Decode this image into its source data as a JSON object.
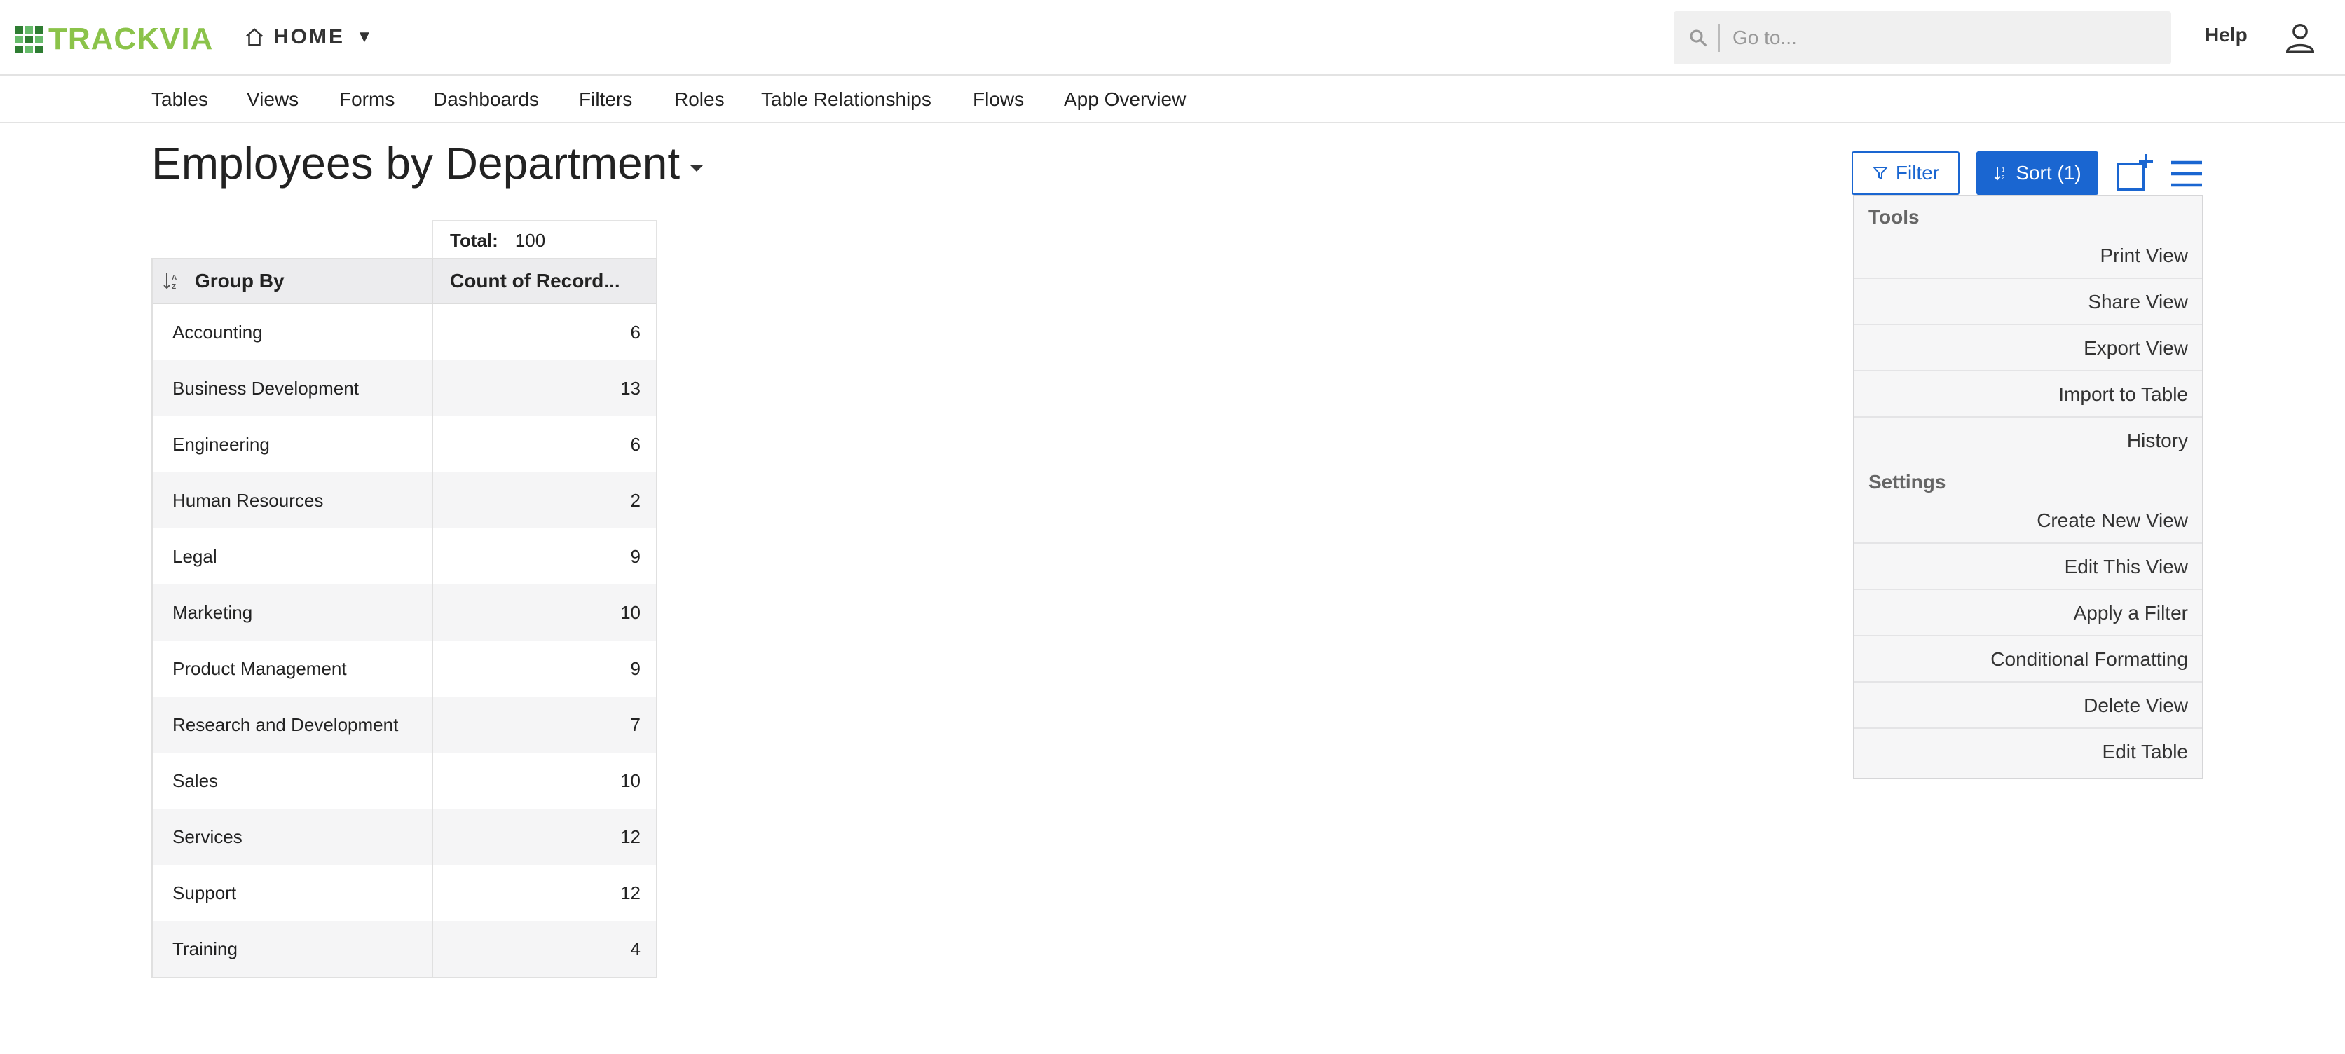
{
  "app": {
    "logo_text": "TRACKVIA",
    "home_label": "HOME",
    "help_label": "Help"
  },
  "search": {
    "placeholder": "Go to..."
  },
  "nav": [
    "Tables",
    "Views",
    "Forms",
    "Dashboards",
    "Filters",
    "Roles",
    "Table Relationships",
    "Flows",
    "App Overview"
  ],
  "view": {
    "title": "Employees by Department",
    "filter_label": "Filter",
    "sort_label": "Sort (1)"
  },
  "menu": {
    "tools_heading": "Tools",
    "tools": [
      "Print View",
      "Share View",
      "Export View",
      "Import to Table",
      "History"
    ],
    "settings_heading": "Settings",
    "settings": [
      "Create New View",
      "Edit This View",
      "Apply a Filter",
      "Conditional Formatting",
      "Delete View",
      "Edit Table"
    ]
  },
  "table": {
    "total_label": "Total:",
    "total_value": "100",
    "columns": [
      "Group By",
      "Count of Record..."
    ],
    "rows": [
      [
        "Accounting",
        "6"
      ],
      [
        "Business Development",
        "13"
      ],
      [
        "Engineering",
        "6"
      ],
      [
        "Human Resources",
        "2"
      ],
      [
        "Legal",
        "9"
      ],
      [
        "Marketing",
        "10"
      ],
      [
        "Product Management",
        "9"
      ],
      [
        "Research and Development",
        "7"
      ],
      [
        "Sales",
        "10"
      ],
      [
        "Services",
        "12"
      ],
      [
        "Support",
        "12"
      ],
      [
        "Training",
        "4"
      ]
    ]
  },
  "colors": {
    "accent": "#1a66d1",
    "logo_green": "#8bc34a"
  }
}
